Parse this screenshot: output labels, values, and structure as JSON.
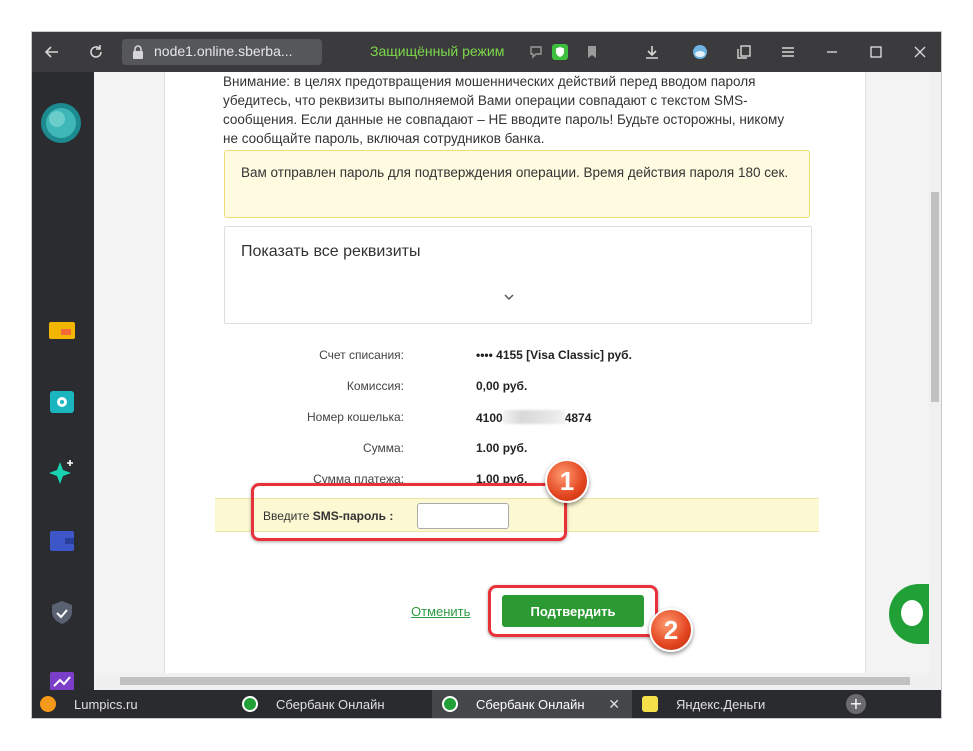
{
  "browser": {
    "address": "node1.online.sberba...",
    "secure_mode": "Защищённый режим"
  },
  "page": {
    "warning": "Внимание: в целях предотвращения мошеннических действий перед вводом пароля убедитесь, что реквизиты выполняемой Вами операции совпадают с текстом SMS-сообщения. Если данные не совпадают – НЕ вводите пароль! Будьте осторожны, никому не сообщайте пароль, включая сотрудников банка.",
    "notice": "Вам отправлен пароль для подтверждения операции. Время действия пароля 180 сек.",
    "details_title": "Показать все реквизиты",
    "rows": [
      {
        "label": "Счет списания:",
        "value": "•••• 4155  [Visa Classic]  руб."
      },
      {
        "label": "Комиссия:",
        "value": "0,00 руб."
      },
      {
        "label": "Номер кошелька:",
        "value_start": "4100",
        "value_end": "4874"
      },
      {
        "label": "Сумма:",
        "value": "1.00 руб."
      },
      {
        "label": "Сумма платежа:",
        "value": "1.00 руб."
      }
    ],
    "sms_label_plain": "Введите ",
    "sms_label_bold": "SMS-пароль :",
    "sms_input_value": "",
    "cancel": "Отменить",
    "confirm": "Подтвердить"
  },
  "annotations": {
    "badge1": "1",
    "badge2": "2",
    "color": "#e8313b"
  },
  "tabs": [
    {
      "label": "Lumpics.ru",
      "icon": "orange-circle-icon"
    },
    {
      "label": "Сбербанк Онлайн",
      "icon": "sberbank-icon"
    },
    {
      "label": "Сбербанк Онлайн",
      "icon": "sberbank-icon",
      "active": true
    },
    {
      "label": "Яндекс.Деньги",
      "icon": "yandex-money-icon"
    }
  ]
}
